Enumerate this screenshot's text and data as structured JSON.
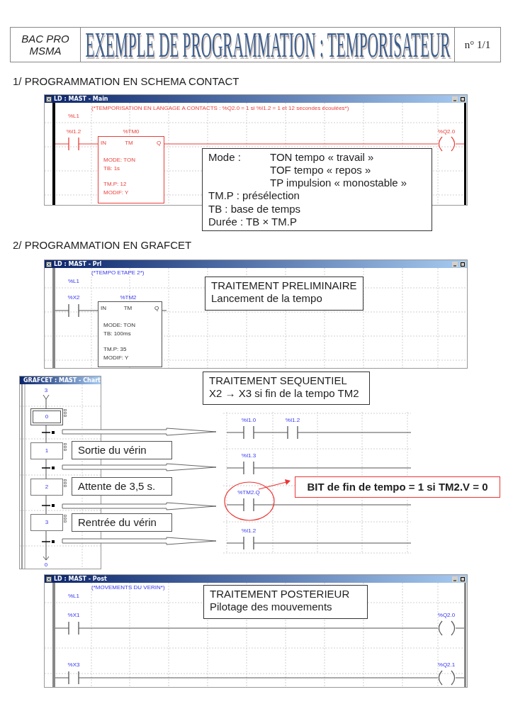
{
  "header": {
    "school": "BAC PRO",
    "course": "MSMA",
    "title": "EXEMPLE DE PROGRAMMATION : TEMPORISATEUR",
    "page_number": "n° 1/1"
  },
  "section_1": {
    "heading": "1/ PROGRAMMATION EN SCHEMA CONTACT",
    "window": {
      "title": "LD : MAST - Main",
      "rung_label": "%L1",
      "comment": "(*TEMPORISATION EN LANGAGE A CONTACTS : %Q2.0 = 1 si %I1.2 = 1 et 12 secondes écoulées*)",
      "contact": "%I1.2",
      "timer": {
        "name": "%TM0",
        "input": "IN",
        "type": "TM",
        "output": "Q",
        "settings": [
          "MODE: TON",
          "TB:  1s",
          "TM.P: 12",
          "MODIF: Y"
        ]
      },
      "coil": "%Q2.0"
    },
    "note": {
      "term": "Mode :",
      "modes": [
        "TON tempo « travail »",
        "TOF tempo « repos »",
        "TP impulsion « monostable »"
      ],
      "lines": [
        "TM.P : présélection",
        "TB : base de temps",
        "Durée : TB × TM.P"
      ]
    }
  },
  "section_2": {
    "heading": "2/ PROGRAMMATION EN GRAFCET",
    "preliminary": {
      "title": "LD : MAST - Prl",
      "rung_label": "%L1",
      "comment": "(*TEMPO ETAPE 2*)",
      "contact": "%X2",
      "timer": {
        "name": "%TM2",
        "input": "IN",
        "type": "TM",
        "output": "Q",
        "settings": [
          "MODE: TON",
          "TB:  100ms",
          "TM.P: 35",
          "MODIF: Y"
        ]
      },
      "note": {
        "title": "TRAITEMENT PRELIMINAIRE",
        "text": "Lancement de la tempo"
      }
    },
    "chart": {
      "title": "GRAFCET : MAST - Chart",
      "entry": "3",
      "exit": "0",
      "steps": [
        {
          "number": "0",
          "initial": true
        },
        {
          "number": "1",
          "initial": false,
          "action": "Sortie du vérin"
        },
        {
          "number": "2",
          "initial": false,
          "action": "Attente de 3,5 s."
        },
        {
          "number": "3",
          "initial": false,
          "action": "Rentrée du vérin"
        }
      ]
    },
    "note": {
      "title": "TRAITEMENT SEQUENTIEL",
      "text": "X2 → X3 si fin de la tempo TM2"
    },
    "transitions": [
      {
        "contacts": [
          "%I1.0",
          "%I1.2"
        ],
        "highlighted": false
      },
      {
        "contacts": [
          "%I1.3"
        ],
        "highlighted": false
      },
      {
        "contacts": [
          "%TM2.Q"
        ],
        "highlighted": true,
        "callout": "BIT de fin de tempo = 1 si TM2.V = 0"
      },
      {
        "contacts": [
          "%I1.2"
        ],
        "highlighted": false
      }
    ],
    "posterior": {
      "title": "LD : MAST - Post",
      "rung_label": "%L1",
      "comment": "(*MOVEMENTS DU VERIN*)",
      "rungs": [
        {
          "contact": "%X1",
          "coil": "%Q2.0"
        },
        {
          "contact": "%X3",
          "coil": "%Q2.1"
        }
      ],
      "note": {
        "title": "TRAITEMENT POSTERIEUR",
        "text": "Pilotage des mouvements"
      }
    }
  }
}
